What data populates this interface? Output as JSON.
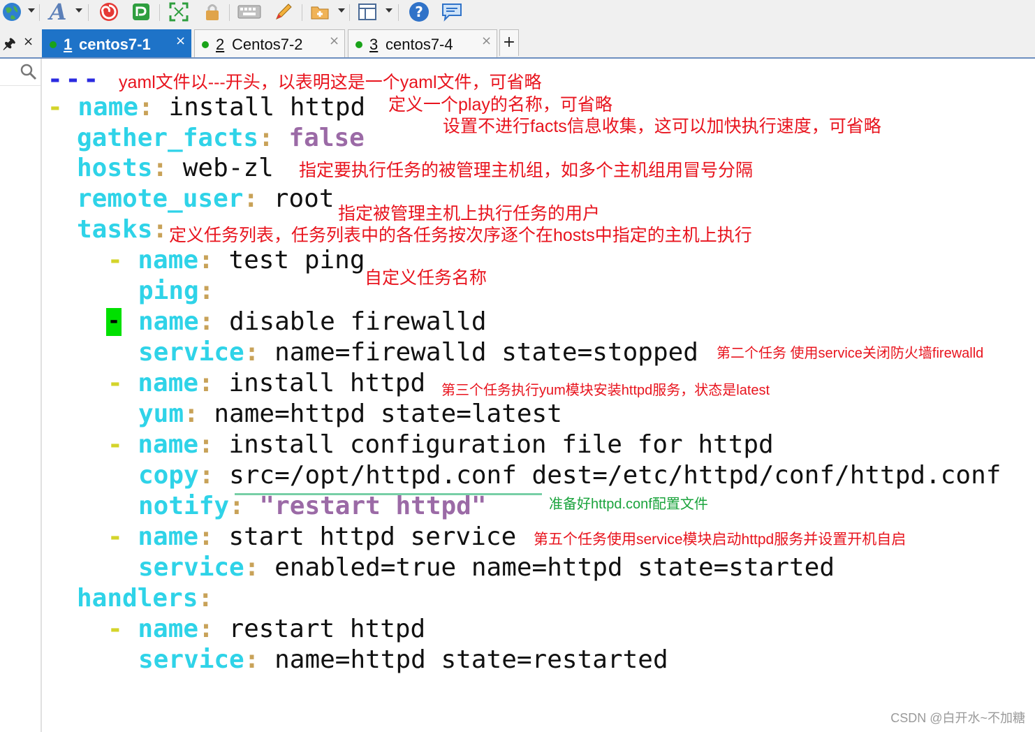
{
  "toolbar": {
    "icons": [
      "globe-icon",
      "font-icon",
      "swirl-icon",
      "session-icon",
      "fullscreen-icon",
      "lock-icon",
      "keyboard-icon",
      "pen-icon",
      "new-folder-icon",
      "layout-icon",
      "help-icon",
      "chat-icon"
    ]
  },
  "tabs": [
    {
      "number": "1",
      "name": "centos7-1",
      "active": true,
      "status_color": "#1aa31a"
    },
    {
      "number": "2",
      "name": "Centos7-2",
      "active": false,
      "status_color": "#1aa31a"
    },
    {
      "number": "3",
      "name": "centos7-4",
      "active": false,
      "status_color": "#1aa31a"
    }
  ],
  "add_tab_label": "+",
  "close_symbol": "×",
  "editor": {
    "lines": {
      "l0": "---",
      "l1_dash": "-",
      "l1_key": "name",
      "l1_val": "install httpd",
      "l2_key": "gather_facts",
      "l2_val": "false",
      "l3_key": "hosts",
      "l3_val": "web-zl",
      "l4_key": "remote_user",
      "l4_val": "root",
      "l5_key": "tasks",
      "l6_key": "name",
      "l6_val": "test ping",
      "l7_key": "ping",
      "l8_key": "name",
      "l8_val": "disable firewalld",
      "l9_key": "service",
      "l9_val": "name=firewalld state=stopped",
      "l10_key": "name",
      "l10_val": "install httpd",
      "l11_key": "yum",
      "l11_val": "name=httpd state=latest",
      "l12_key": "name",
      "l12_val": "install configuration file for httpd",
      "l13_key": "copy",
      "l13_val": "src=/opt/httpd.conf dest=/etc/httpd/conf/httpd.conf",
      "l14_key": "notify",
      "l14_val": "\"restart httpd\"",
      "l15_key": "name",
      "l15_val": "start httpd service",
      "l16_key": "service",
      "l16_val": "enabled=true name=httpd state=started",
      "l17_key": "handlers",
      "l18_key": "name",
      "l18_val": "restart httpd",
      "l19_key": "service",
      "l19_val": "name=httpd state=restarted"
    },
    "dash": "-",
    "colon": ":",
    "cursor_char": "-"
  },
  "annotations": {
    "a1": "yaml文件以---开头，以表明这是一个yaml文件，可省略",
    "a2": "定义一个play的名称，可省略",
    "a3": "设置不进行facts信息收集，这可以加快执行速度，可省略",
    "a4": "指定要执行任务的被管理主机组，如多个主机组用冒号分隔",
    "a5": "指定被管理主机上执行任务的用户",
    "a6": "定义任务列表，任务列表中的各任务按次序逐个在hosts中指定的主机上执行",
    "a7": "自定义任务名称",
    "a8": "第二个任务  使用service关闭防火墙firewalld",
    "a9": "第三个任务执行yum模块安装httpd服务，状态是latest",
    "a10": "准备好httpd.conf配置文件",
    "a11": "第五个任务使用service模块启动httpd服务并设置开机自启"
  },
  "watermark": "CSDN @白开水~不加糖",
  "colors": {
    "key": "#2fd3e8",
    "colon": "#c8a258",
    "dash": "#d4d42a",
    "boolean_string": "#9b6aa6",
    "separator": "#2a2ae0",
    "annotation_red": "#e8141e",
    "annotation_green": "#1aa33c",
    "active_tab": "#1e73c8",
    "cursor": "#00e000"
  }
}
